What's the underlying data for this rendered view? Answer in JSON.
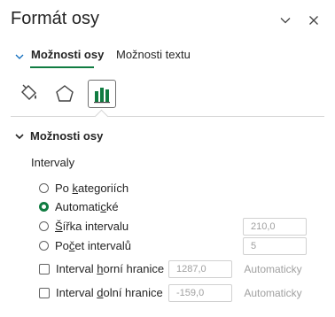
{
  "pane": {
    "title": "Formát osy"
  },
  "tabs": [
    {
      "label": "Možnosti osy",
      "active": true
    },
    {
      "label": "Možnosti textu",
      "active": false
    }
  ],
  "icon_tabs": [
    {
      "name": "paint-bucket-icon"
    },
    {
      "name": "pentagon-icon"
    },
    {
      "name": "bar-chart-icon",
      "selected": true
    }
  ],
  "section": {
    "title": "Možnosti osy",
    "intervals_label": "Intervaly",
    "options": [
      {
        "prefix": "Po ",
        "mnemonic": "k",
        "suffix": "ategoriích",
        "checked": false
      },
      {
        "prefix": "Automati",
        "mnemonic": "c",
        "suffix": "ké",
        "checked": true
      },
      {
        "prefix": "",
        "mnemonic": "Š",
        "suffix": "ířka intervalu",
        "checked": false,
        "value": "210,0"
      },
      {
        "prefix": "Po",
        "mnemonic": "č",
        "suffix": "et intervalů",
        "checked": false,
        "value": "5"
      }
    ],
    "bounds": [
      {
        "prefix": "Interval ",
        "mnemonic": "h",
        "suffix": "orní hranice",
        "value": "1287,0",
        "button": "Automaticky"
      },
      {
        "prefix": "Interval ",
        "mnemonic": "d",
        "suffix": "olní hranice",
        "value": "-159,0",
        "button": "Automaticky"
      }
    ]
  },
  "colors": {
    "accent": "#107c41",
    "text": "#242424",
    "disabled": "#a0a0a0"
  }
}
